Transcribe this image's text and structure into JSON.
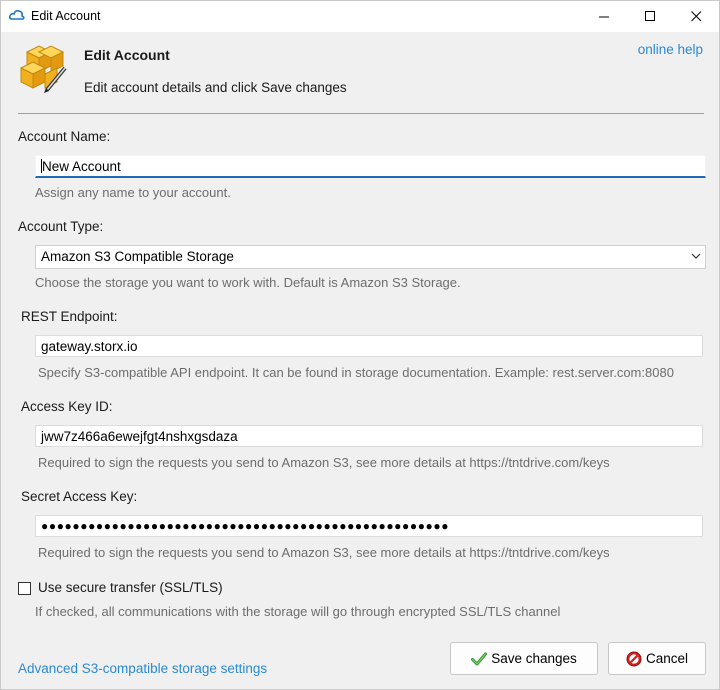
{
  "window": {
    "title": "Edit Account",
    "controls": {
      "minimize": "—",
      "maximize": "☐",
      "close": "✕"
    }
  },
  "header": {
    "title": "Edit Account",
    "subtitle": "Edit account details and click Save changes",
    "online_help": "online help"
  },
  "form": {
    "account_name": {
      "label": "Account Name:",
      "value": "New Account",
      "hint": "Assign any name to your account."
    },
    "account_type": {
      "label": "Account Type:",
      "value": "Amazon S3 Compatible Storage",
      "hint": "Choose the storage you want to work with. Default is Amazon S3 Storage."
    },
    "rest_endpoint": {
      "label": "REST Endpoint:",
      "value": "gateway.storx.io",
      "hint": "Specify S3-compatible API endpoint. It can be found in storage documentation. Example: rest.server.com:8080"
    },
    "access_key": {
      "label": "Access Key ID:",
      "value": "jww7z466a6ewejfgt4nshxgsdaza",
      "hint": "Required to sign the requests you send to Amazon S3, see more details at https://tntdrive.com/keys"
    },
    "secret_key": {
      "label": "Secret Access Key:",
      "value": "●●●●●●●●●●●●●●●●●●●●●●●●●●●●●●●●●●●●●●●●●●●●●●●●●●●●",
      "hint": "Required to sign the requests you send to Amazon S3, see more details at https://tntdrive.com/keys"
    },
    "secure_transfer": {
      "label": "Use secure transfer (SSL/TLS)",
      "checked": false,
      "hint": "If checked, all communications with the storage will go through encrypted SSL/TLS channel"
    }
  },
  "footer": {
    "advanced_link": "Advanced S3-compatible storage settings",
    "save_label": "Save changes",
    "cancel_label": "Cancel"
  },
  "colors": {
    "link": "#2a8ad4",
    "focus_underline": "#1e6ab8",
    "hint": "#6d6d6d"
  }
}
